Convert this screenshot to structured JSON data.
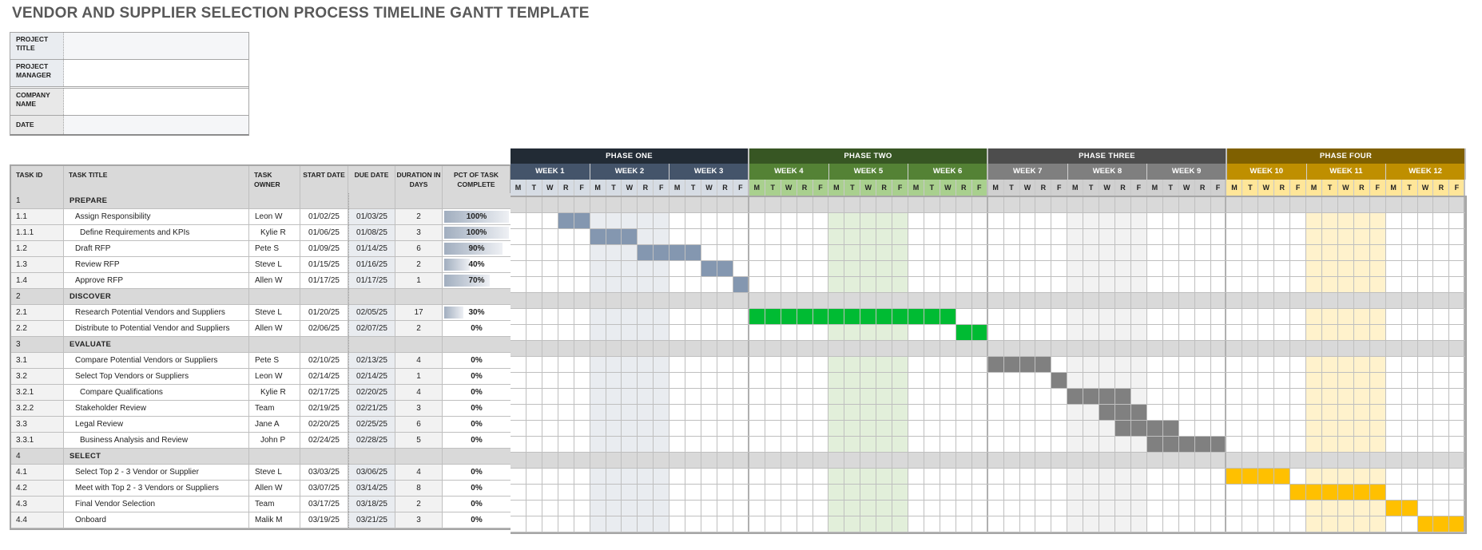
{
  "title": "VENDOR AND SUPPLIER SELECTION PROCESS TIMELINE GANTT TEMPLATE",
  "project_info": [
    {
      "label": "PROJECT TITLE",
      "value": ""
    },
    {
      "label": "PROJECT MANAGER",
      "value": ""
    },
    {
      "label": "COMPANY NAME",
      "value": ""
    },
    {
      "label": "DATE",
      "value": ""
    }
  ],
  "columns": {
    "id": "TASK ID",
    "title": "TASK TITLE",
    "owner": "TASK OWNER",
    "start": "START DATE",
    "due": "DUE DATE",
    "duration": "DURATION IN DAYS",
    "pct": "PCT OF TASK COMPLETE"
  },
  "day_letters": [
    "M",
    "T",
    "W",
    "R",
    "F"
  ],
  "phases": [
    {
      "label": "PHASE ONE",
      "color": "#222b35",
      "week_color": "#44546a",
      "day_color": "#d6dce4",
      "band_color": "#e9ecf0",
      "bar_color": "#8497b0",
      "weeks": [
        "WEEK 1",
        "WEEK 2",
        "WEEK 3"
      ]
    },
    {
      "label": "PHASE TWO",
      "color": "#375623",
      "week_color": "#548235",
      "day_color": "#a9d08e",
      "band_color": "#e2efda",
      "bar_color": "#00bb33",
      "weeks": [
        "WEEK 4",
        "WEEK 5",
        "WEEK 6"
      ]
    },
    {
      "label": "PHASE THREE",
      "color": "#4d4d4d",
      "week_color": "#7f7f7f",
      "day_color": "#d0d0d0",
      "band_color": "#f2f2f2",
      "bar_color": "#808080",
      "weeks": [
        "WEEK 7",
        "WEEK 8",
        "WEEK 9"
      ]
    },
    {
      "label": "PHASE FOUR",
      "color": "#7f6000",
      "week_color": "#bf8f00",
      "day_color": "#ffe699",
      "band_color": "#fff2cc",
      "bar_color": "#ffc000",
      "weeks": [
        "WEEK 10",
        "WEEK 11",
        "WEEK 12"
      ]
    }
  ],
  "tasks": [
    {
      "id": "1",
      "title": "PREPARE",
      "type": "phase",
      "phase": 0
    },
    {
      "id": "1.1",
      "title": "Assign Responsibility",
      "owner": "Leon W",
      "start": "01/02/25",
      "due": "01/03/25",
      "duration": "2",
      "pct": 100,
      "pct_label": "100%",
      "level": 2,
      "phase": 0,
      "bar_start_day": 3,
      "bar_days": 2
    },
    {
      "id": "1.1.1",
      "title": "Define Requirements and KPIs",
      "owner": "Kylie R",
      "start": "01/06/25",
      "due": "01/08/25",
      "duration": "3",
      "pct": 100,
      "pct_label": "100%",
      "level": 3,
      "phase": 0,
      "bar_start_day": 5,
      "bar_days": 3
    },
    {
      "id": "1.2",
      "title": "Draft RFP",
      "owner": "Pete S",
      "start": "01/09/25",
      "due": "01/14/25",
      "duration": "6",
      "pct": 90,
      "pct_label": "90%",
      "level": 2,
      "phase": 0,
      "bar_start_day": 8,
      "bar_days": 4
    },
    {
      "id": "1.3",
      "title": "Review RFP",
      "owner": "Steve L",
      "start": "01/15/25",
      "due": "01/16/25",
      "duration": "2",
      "pct": 40,
      "pct_label": "40%",
      "level": 2,
      "phase": 0,
      "bar_start_day": 12,
      "bar_days": 2
    },
    {
      "id": "1.4",
      "title": "Approve RFP",
      "owner": "Allen W",
      "start": "01/17/25",
      "due": "01/17/25",
      "duration": "1",
      "pct": 70,
      "pct_label": "70%",
      "level": 2,
      "phase": 0,
      "bar_start_day": 14,
      "bar_days": 1
    },
    {
      "id": "2",
      "title": "DISCOVER",
      "type": "phase",
      "phase": 1
    },
    {
      "id": "2.1",
      "title": "Research Potential Vendors and Suppliers",
      "owner": "Steve L",
      "start": "01/20/25",
      "due": "02/05/25",
      "duration": "17",
      "pct": 30,
      "pct_label": "30%",
      "level": 2,
      "phase": 1,
      "bar_start_day": 15,
      "bar_days": 13
    },
    {
      "id": "2.2",
      "title": "Distribute to Potential Vendor and Suppliers",
      "owner": "Allen W",
      "start": "02/06/25",
      "due": "02/07/25",
      "duration": "2",
      "pct": 0,
      "pct_label": "0%",
      "level": 2,
      "phase": 1,
      "bar_start_day": 28,
      "bar_days": 2
    },
    {
      "id": "3",
      "title": "EVALUATE",
      "type": "phase",
      "phase": 2
    },
    {
      "id": "3.1",
      "title": "Compare Potential Vendors or Suppliers",
      "owner": "Pete S",
      "start": "02/10/25",
      "due": "02/13/25",
      "duration": "4",
      "pct": 0,
      "pct_label": "0%",
      "level": 2,
      "phase": 2,
      "bar_start_day": 30,
      "bar_days": 4
    },
    {
      "id": "3.2",
      "title": "Select Top Vendors or Suppliers",
      "owner": "Leon W",
      "start": "02/14/25",
      "due": "02/14/25",
      "duration": "1",
      "pct": 0,
      "pct_label": "0%",
      "level": 2,
      "phase": 2,
      "bar_start_day": 34,
      "bar_days": 1
    },
    {
      "id": "3.2.1",
      "title": "Compare Qualifications",
      "owner": "Kylie R",
      "start": "02/17/25",
      "due": "02/20/25",
      "duration": "4",
      "pct": 0,
      "pct_label": "0%",
      "level": 3,
      "phase": 2,
      "bar_start_day": 35,
      "bar_days": 4
    },
    {
      "id": "3.2.2",
      "title": "Stakeholder Review",
      "owner": "Team",
      "start": "02/19/25",
      "due": "02/21/25",
      "duration": "3",
      "pct": 0,
      "pct_label": "0%",
      "level": 2,
      "phase": 2,
      "bar_start_day": 37,
      "bar_days": 3
    },
    {
      "id": "3.3",
      "title": "Legal Review",
      "owner": "Jane A",
      "start": "02/20/25",
      "due": "02/25/25",
      "duration": "6",
      "pct": 0,
      "pct_label": "0%",
      "level": 2,
      "phase": 2,
      "bar_start_day": 38,
      "bar_days": 4
    },
    {
      "id": "3.3.1",
      "title": "Business Analysis and Review",
      "owner": "John P",
      "start": "02/24/25",
      "due": "02/28/25",
      "duration": "5",
      "pct": 0,
      "pct_label": "0%",
      "level": 3,
      "phase": 2,
      "bar_start_day": 40,
      "bar_days": 5
    },
    {
      "id": "4",
      "title": "SELECT",
      "type": "phase",
      "phase": 3
    },
    {
      "id": "4.1",
      "title": "Select Top 2 - 3 Vendor or Supplier",
      "owner": "Steve L",
      "start": "03/03/25",
      "due": "03/06/25",
      "duration": "4",
      "pct": 0,
      "pct_label": "0%",
      "level": 2,
      "phase": 3,
      "bar_start_day": 45,
      "bar_days": 4
    },
    {
      "id": "4.2",
      "title": "Meet with Top 2 - 3 Vendors or Suppliers",
      "owner": "Allen W",
      "start": "03/07/25",
      "due": "03/14/25",
      "duration": "8",
      "pct": 0,
      "pct_label": "0%",
      "level": 2,
      "phase": 3,
      "bar_start_day": 49,
      "bar_days": 6
    },
    {
      "id": "4.3",
      "title": "Final Vendor Selection",
      "owner": "Team",
      "start": "03/17/25",
      "due": "03/18/25",
      "duration": "2",
      "pct": 0,
      "pct_label": "0%",
      "level": 2,
      "phase": 3,
      "bar_start_day": 55,
      "bar_days": 2
    },
    {
      "id": "4.4",
      "title": "Onboard",
      "owner": "Malik M",
      "start": "03/19/25",
      "due": "03/21/25",
      "duration": "3",
      "pct": 0,
      "pct_label": "0%",
      "level": 2,
      "phase": 3,
      "bar_start_day": 57,
      "bar_days": 3
    }
  ]
}
